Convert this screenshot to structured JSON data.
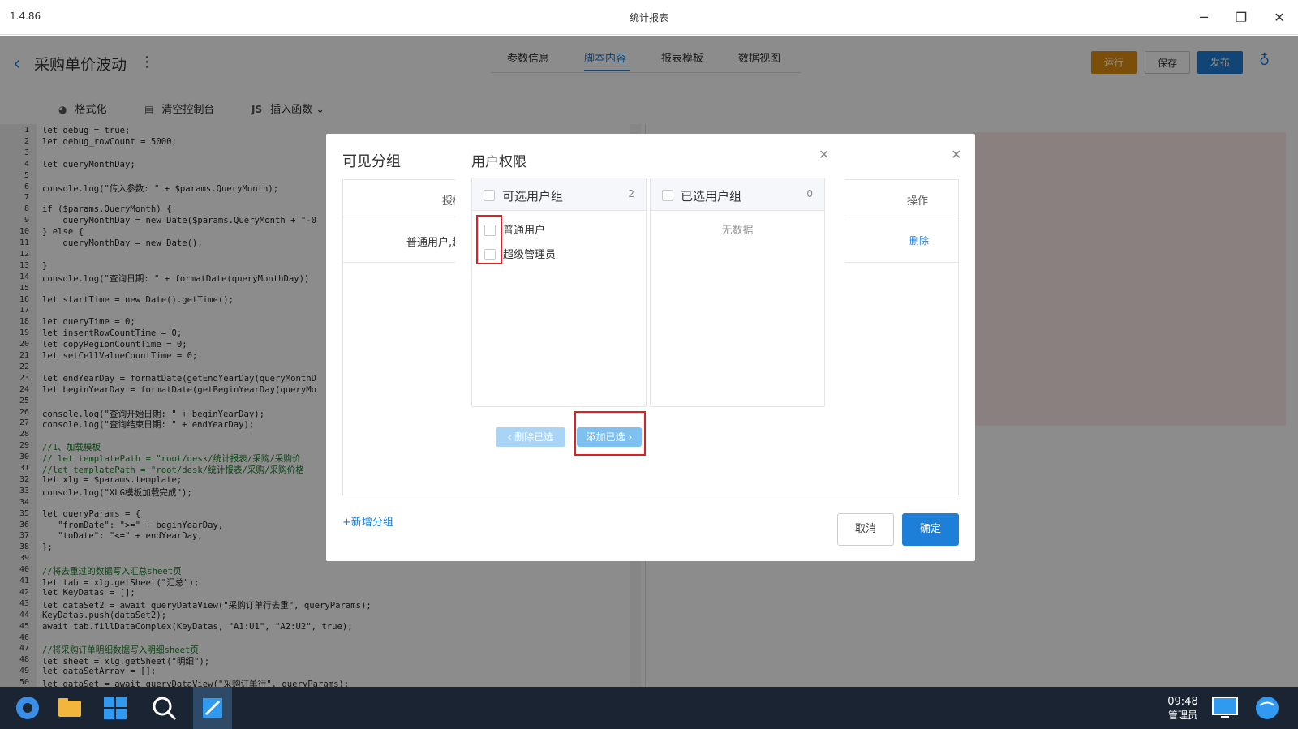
{
  "titlebar": {
    "version": "1.4.86",
    "title": "统计报表",
    "minimize": "─",
    "restore": "❐",
    "close": "✕"
  },
  "header": {
    "back": "‹",
    "title": "采购单价波动",
    "more": "⋮",
    "tabs": [
      "参数信息",
      "脚本内容",
      "报表模板",
      "数据视图"
    ],
    "run": "运行",
    "save": "保存",
    "publish": "发布",
    "extra_icon": "♁",
    "colors": {
      "run": "#e08f12",
      "publish": "#1e7fd8"
    }
  },
  "toolbar": {
    "format": "格式化",
    "format_icon": "◕",
    "clear": "清空控制台",
    "clear_icon": "▤",
    "insert": "插入函数",
    "insert_prefix": "JS",
    "insert_arrow": "⌄"
  },
  "editor": {
    "lines": [
      "let debug = true;",
      "let debug_rowCount = 5000;",
      "",
      "let queryMonthDay;",
      "",
      "console.log(\"传入参数: \" + $params.QueryMonth);",
      "",
      "if ($params.QueryMonth) {",
      "    queryMonthDay = new Date($params.QueryMonth + \"-0",
      "} else {",
      "    queryMonthDay = new Date();",
      "",
      "}",
      "console.log(\"查询日期: \" + formatDate(queryMonthDay))",
      "",
      "let startTime = new Date().getTime();",
      "",
      "let queryTime = 0;",
      "let insertRowCountTime = 0;",
      "let copyRegionCountTime = 0;",
      "let setCellValueCountTime = 0;",
      "",
      "let endYearDay = formatDate(getEndYearDay(queryMonthD",
      "let beginYearDay = formatDate(getBeginYearDay(queryMo",
      "",
      "console.log(\"查询开始日期: \" + beginYearDay);",
      "console.log(\"查询结束日期: \" + endYearDay);",
      "",
      "//1、加载模板",
      "// let templatePath = \"root/desk/统计报表/采购/采购价",
      "//let templatePath = \"root/desk/统计报表/采购/采购价格",
      "let xlg = $params.template;",
      "console.log(\"XLG模板加载完成\");",
      "",
      "let queryParams = {",
      "   \"fromDate\": \">=\" + beginYearDay,",
      "   \"toDate\": \"<=\" + endYearDay,",
      "};",
      "",
      "//将去重过的数据写入汇总sheet页",
      "let tab = xlg.getSheet(\"汇总\");",
      "let KeyDatas = [];",
      "let dataSet2 = await queryDataView(\"采购订单行去重\", queryParams);",
      "KeyDatas.push(dataSet2);",
      "await tab.fillDataComplex(KeyDatas, \"A1:U1\", \"A2:U2\", true);",
      "",
      "//将采购订单明细数据写入明细sheet页",
      "let sheet = xlg.getSheet(\"明细\");",
      "let dataSetArray = [];",
      "let dataSet = await queryDataView(\"采购订单行\", queryParams);"
    ]
  },
  "visible_group": {
    "title": "可见分组",
    "col_auth": "授权",
    "col_op": "操作",
    "row_users": "普通用户,超",
    "row_delete": "删除",
    "add_group": "+新增分组",
    "cancel": "取消",
    "ok": "确定",
    "close": "✕"
  },
  "user_perm": {
    "title": "用户权限",
    "close": "✕",
    "left": {
      "title": "可选用户组",
      "count": "2",
      "items": [
        "普通用户",
        "超级管理员"
      ]
    },
    "right": {
      "title": "已选用户组",
      "count": "0",
      "empty": "无数据"
    },
    "remove_btn": "删除已选",
    "add_btn": "添加已选"
  },
  "taskbar": {
    "time": "09:48",
    "user": "管理员"
  }
}
